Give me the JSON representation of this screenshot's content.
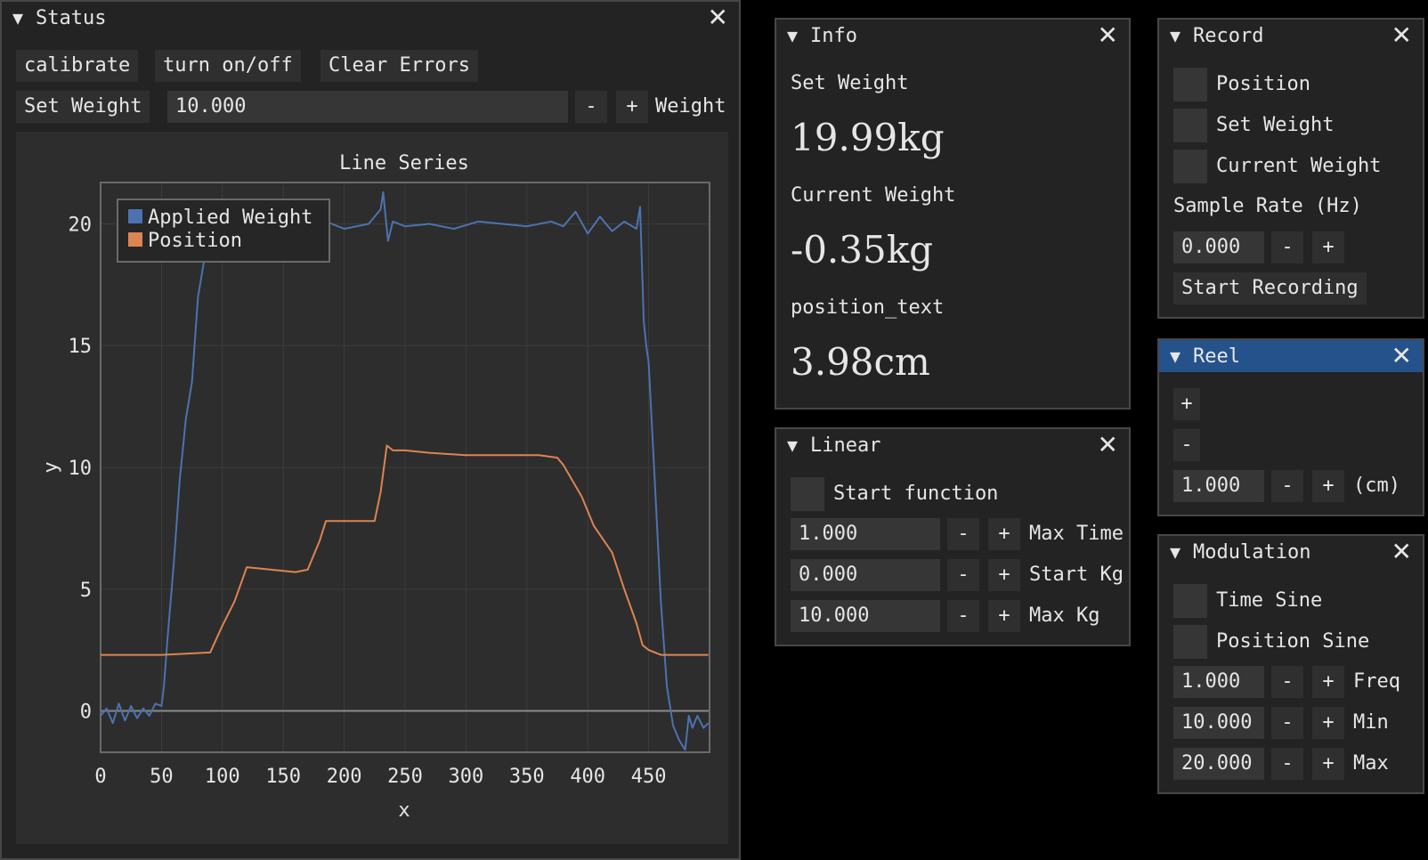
{
  "status": {
    "title": "Status",
    "calibrate": "calibrate",
    "turn_on_off": "turn on/off",
    "clear_errors": "Clear Errors",
    "set_weight_button": "Set Weight",
    "weight_value": "10.000",
    "minus": "-",
    "plus": "+",
    "weight_label": "Weight"
  },
  "chart_data": {
    "type": "line",
    "title": "Line Series",
    "xlabel": "x",
    "ylabel": "y",
    "xlim": [
      0,
      500
    ],
    "ylim": [
      -1.7,
      21.7
    ],
    "xticks": [
      0,
      50,
      100,
      150,
      200,
      250,
      300,
      350,
      400,
      450
    ],
    "yticks": [
      0,
      5,
      10,
      15,
      20
    ],
    "legend_position": "top-left",
    "grid": true,
    "series": [
      {
        "name": "Applied Weight",
        "color": "#4c72b0",
        "x": [
          0,
          5,
          10,
          15,
          20,
          25,
          30,
          35,
          40,
          45,
          50,
          52,
          55,
          60,
          65,
          70,
          75,
          80,
          85,
          88,
          90,
          95,
          100,
          110,
          130,
          150,
          180,
          200,
          220,
          230,
          232,
          236,
          240,
          250,
          270,
          290,
          310,
          330,
          350,
          370,
          380,
          390,
          400,
          410,
          420,
          430,
          440,
          443,
          446,
          448,
          450,
          455,
          460,
          465,
          470,
          475,
          480,
          483,
          486,
          490,
          495,
          499
        ],
        "y": [
          -0.2,
          0.1,
          -0.5,
          0.3,
          -0.4,
          0.2,
          -0.3,
          0.1,
          -0.2,
          0.3,
          0.2,
          1.0,
          3.0,
          6.0,
          9.5,
          12.0,
          13.5,
          17.0,
          18.5,
          20.5,
          20.0,
          19.8,
          20.4,
          20.0,
          20.1,
          19.9,
          20.2,
          19.8,
          20.0,
          20.6,
          21.3,
          19.3,
          20.1,
          19.9,
          20.0,
          19.8,
          20.1,
          20.0,
          19.9,
          20.1,
          19.9,
          20.5,
          19.6,
          20.3,
          19.7,
          20.1,
          19.8,
          20.7,
          16.0,
          15.0,
          14.3,
          9.5,
          4.5,
          1.0,
          -0.6,
          -1.2,
          -1.6,
          -0.2,
          -0.7,
          -0.2,
          -0.7,
          -0.5
        ]
      },
      {
        "name": "Position",
        "color": "#dd8452",
        "x": [
          0,
          50,
          90,
          100,
          110,
          120,
          160,
          170,
          180,
          185,
          190,
          225,
          230,
          235,
          240,
          250,
          270,
          300,
          330,
          360,
          375,
          380,
          395,
          405,
          420,
          430,
          440,
          445,
          450,
          460,
          499
        ],
        "y": [
          2.3,
          2.3,
          2.4,
          3.5,
          4.5,
          5.9,
          5.7,
          5.8,
          7.0,
          7.8,
          7.8,
          7.8,
          9.0,
          10.9,
          10.7,
          10.7,
          10.6,
          10.5,
          10.5,
          10.5,
          10.4,
          10.1,
          8.8,
          7.6,
          6.5,
          5.0,
          3.6,
          2.7,
          2.5,
          2.3,
          2.3
        ]
      }
    ]
  },
  "info": {
    "title": "Info",
    "set_weight_label": "Set Weight",
    "set_weight_value": "19.99kg",
    "current_weight_label": "Current Weight",
    "current_weight_value": "-0.35kg",
    "position_label": "position_text",
    "position_value": "3.98cm"
  },
  "linear": {
    "title": "Linear",
    "start_function": "Start function",
    "rows": [
      {
        "value": "1.000",
        "label": "Max Time"
      },
      {
        "value": "0.000",
        "label": "Start Kg"
      },
      {
        "value": "10.000",
        "label": "Max Kg"
      }
    ]
  },
  "record": {
    "title": "Record",
    "checks": [
      "Position",
      "Set Weight",
      "Current Weight"
    ],
    "sample_rate_label": "Sample Rate (Hz)",
    "sample_rate_value": "0.000",
    "start_recording": "Start Recording"
  },
  "reel": {
    "title": "Reel",
    "plus": "+",
    "minus": "-",
    "value": "1.000",
    "unit": "(cm)"
  },
  "modulation": {
    "title": "Modulation",
    "checks": [
      "Time Sine",
      "Position Sine"
    ],
    "rows": [
      {
        "value": "1.000",
        "label": "Freq"
      },
      {
        "value": "10.000",
        "label": "Min"
      },
      {
        "value": "20.000",
        "label": "Max"
      }
    ]
  }
}
